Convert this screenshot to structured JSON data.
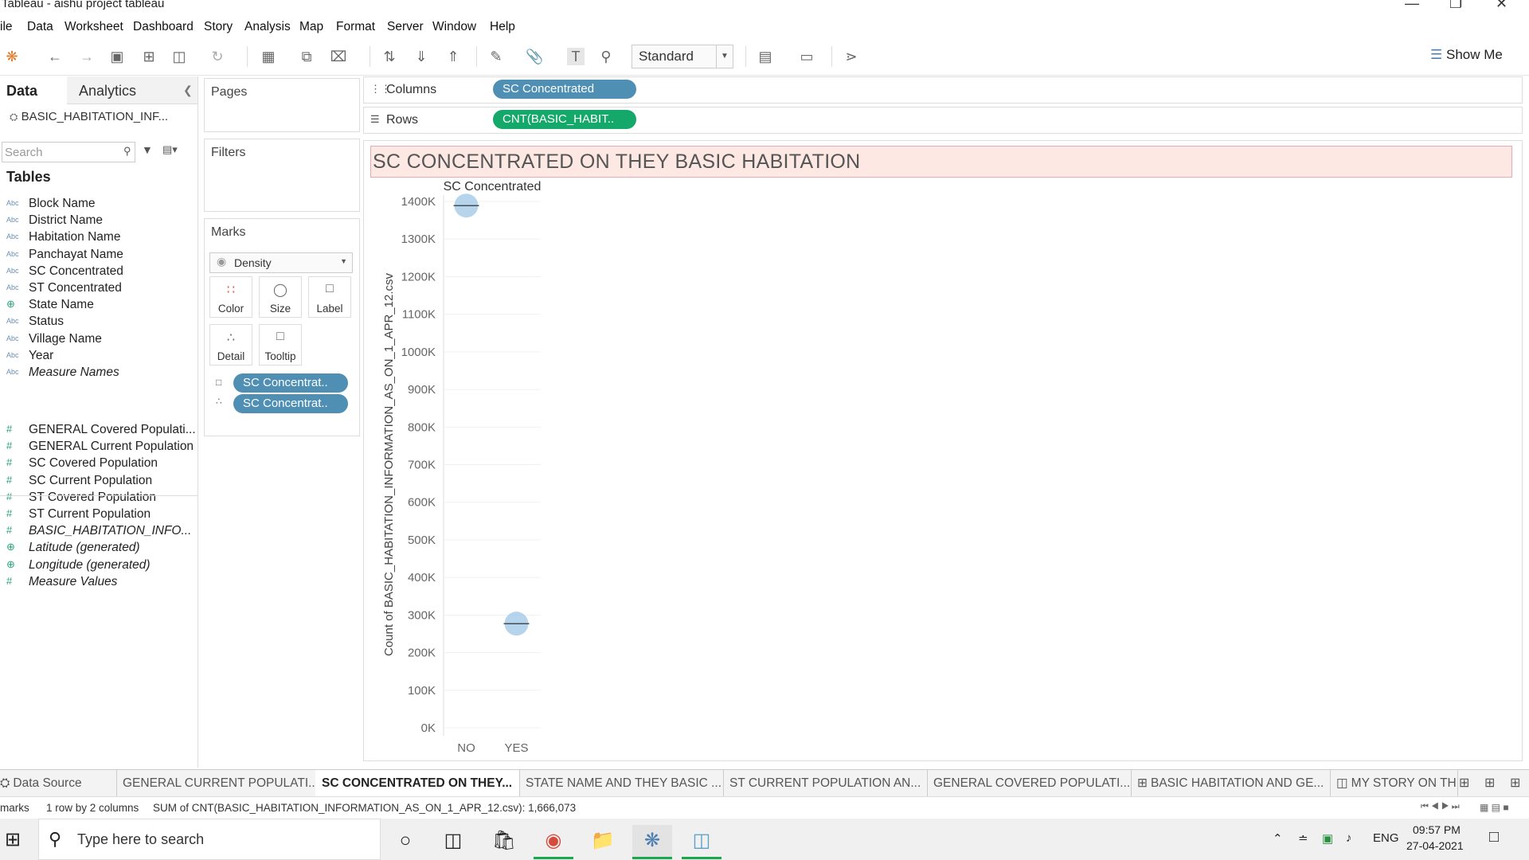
{
  "window": {
    "title": "Tableau - aishu project tableau"
  },
  "menu": [
    "ile",
    "Data",
    "Worksheet",
    "Dashboard",
    "Story",
    "Analysis",
    "Map",
    "Format",
    "Server",
    "Window",
    "Help"
  ],
  "toolbar": {
    "fit_mode": "Standard",
    "show_me": "Show Me"
  },
  "data_pane": {
    "tab_data": "Data",
    "tab_analytics": "Analytics",
    "datasource": "BASIC_HABITATION_INF...",
    "search_placeholder": "Search",
    "tables_heading": "Tables",
    "dimensions": [
      {
        "type": "Abc",
        "name": "Block Name"
      },
      {
        "type": "Abc",
        "name": "District Name"
      },
      {
        "type": "Abc",
        "name": "Habitation Name"
      },
      {
        "type": "Abc",
        "name": "Panchayat Name"
      },
      {
        "type": "Abc",
        "name": "SC Concentrated"
      },
      {
        "type": "Abc",
        "name": "ST Concentrated"
      },
      {
        "type": "globe",
        "name": "State Name"
      },
      {
        "type": "Abc",
        "name": "Status"
      },
      {
        "type": "Abc",
        "name": "Village Name"
      },
      {
        "type": "Abc",
        "name": "Year"
      },
      {
        "type": "Abc",
        "name": "Measure Names"
      }
    ],
    "measures": [
      {
        "type": "#",
        "name": "GENERAL Covered Populati..."
      },
      {
        "type": "#",
        "name": "GENERAL Current Population"
      },
      {
        "type": "#",
        "name": "SC Covered Population"
      },
      {
        "type": "#",
        "name": "SC Current Population"
      },
      {
        "type": "#",
        "name": "ST Covered Population"
      },
      {
        "type": "#",
        "name": "ST Current Population"
      },
      {
        "type": "#",
        "name": "BASIC_HABITATION_INFO..."
      },
      {
        "type": "globe",
        "name": "Latitude (generated)"
      },
      {
        "type": "globe",
        "name": "Longitude (generated)"
      },
      {
        "type": "#",
        "name": "Measure Values"
      }
    ]
  },
  "cards": {
    "pages": "Pages",
    "filters": "Filters",
    "marks": "Marks",
    "mark_type": "Density",
    "mark_buttons": [
      "Color",
      "Size",
      "Label",
      "Detail",
      "Tooltip"
    ],
    "mark_pills": [
      "SC Concentrat..",
      "SC Concentrat.."
    ]
  },
  "shelves": {
    "columns_label": "Columns",
    "columns_pill": "SC Concentrated",
    "rows_label": "Rows",
    "rows_pill": "CNT(BASIC_HABIT.."
  },
  "view": {
    "title": "SC CONCENTRATED ON THEY BASIC HABITATION"
  },
  "chart_data": {
    "type": "scatter",
    "mark": "density",
    "title": "SC Concentrated",
    "ylabel": "Count of BASIC_HABITATION_INFORMATION_AS_ON_1_APR_12.csv",
    "categories": [
      "NO",
      "YES"
    ],
    "values": [
      1389000,
      277073
    ],
    "yticks": [
      "0K",
      "100K",
      "200K",
      "300K",
      "400K",
      "500K",
      "600K",
      "700K",
      "800K",
      "900K",
      "1000K",
      "1100K",
      "1200K",
      "1300K",
      "1400K"
    ],
    "ylim": [
      0,
      1400000
    ],
    "color": "#a9cde9"
  },
  "sheet_tabs": [
    {
      "label": "Data Source",
      "icon": "datasource",
      "active": false
    },
    {
      "label": "GENERAL CURRENT POPULATI...",
      "active": false
    },
    {
      "label": "SC CONCENTRATED ON THEY...",
      "active": true
    },
    {
      "label": "STATE NAME AND THEY BASIC ...",
      "active": false
    },
    {
      "label": "ST CURRENT POPULATION AN...",
      "active": false
    },
    {
      "label": "GENERAL COVERED POPULATI...",
      "active": false
    },
    {
      "label": "BASIC HABITATION AND GE...",
      "icon": "dashboard",
      "active": false
    },
    {
      "label": "MY STORY ON THE",
      "icon": "story",
      "active": false
    }
  ],
  "status": {
    "marks": "marks",
    "dims": "1 row by 2 columns",
    "sum": "SUM of CNT(BASIC_HABITATION_INFORMATION_AS_ON_1_APR_12.csv): 1,666,073"
  },
  "taskbar": {
    "search_placeholder": "Type here to search",
    "lang": "ENG",
    "time": "09:57 PM",
    "date": "27-04-2021"
  }
}
